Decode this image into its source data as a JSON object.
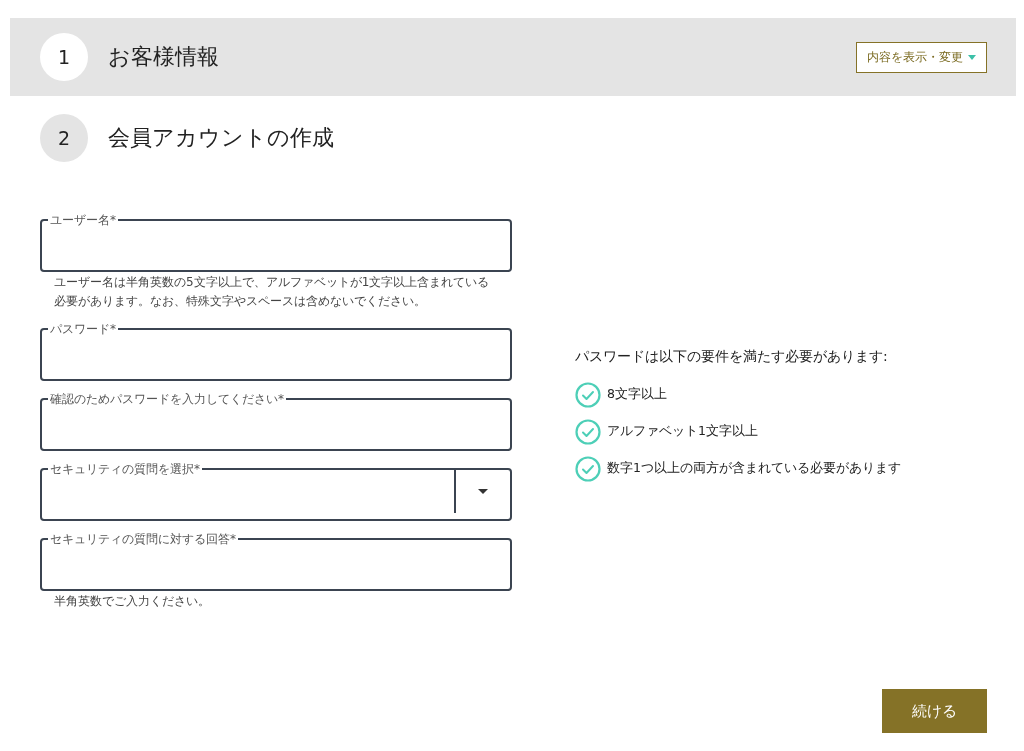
{
  "steps": [
    {
      "number": "1",
      "title": "お客様情報",
      "completed": true,
      "action": "内容を表示・変更"
    },
    {
      "number": "2",
      "title": "会員アカウントの作成",
      "completed": false
    }
  ],
  "fields": [
    {
      "kind": "text",
      "label": "ユーザー名*",
      "hint": "ユーザー名は半角英数の5文字以上で、アルファベットが1文字以上含まれている必要があります。なお、特殊文字やスペースは含めないでください。"
    },
    {
      "kind": "text",
      "label": "パスワード*"
    },
    {
      "kind": "text",
      "label": "確認のためパスワードを入力してください*"
    },
    {
      "kind": "select",
      "label": "セキュリティの質問を選択*"
    },
    {
      "kind": "text",
      "label": "セキュリティの質問に対する回答*",
      "hint": "半角英数でご入力ください。"
    }
  ],
  "requirements": {
    "heading": "パスワードは以下の要件を満たす必要があります:",
    "items": [
      {
        "text": "8文字以上",
        "met": true
      },
      {
        "text": "アルファベット1文字以上",
        "met": true
      },
      {
        "text": "数字1つ以上の両方が含まれている必要があります",
        "met": true
      }
    ]
  },
  "continue_button": "続ける"
}
